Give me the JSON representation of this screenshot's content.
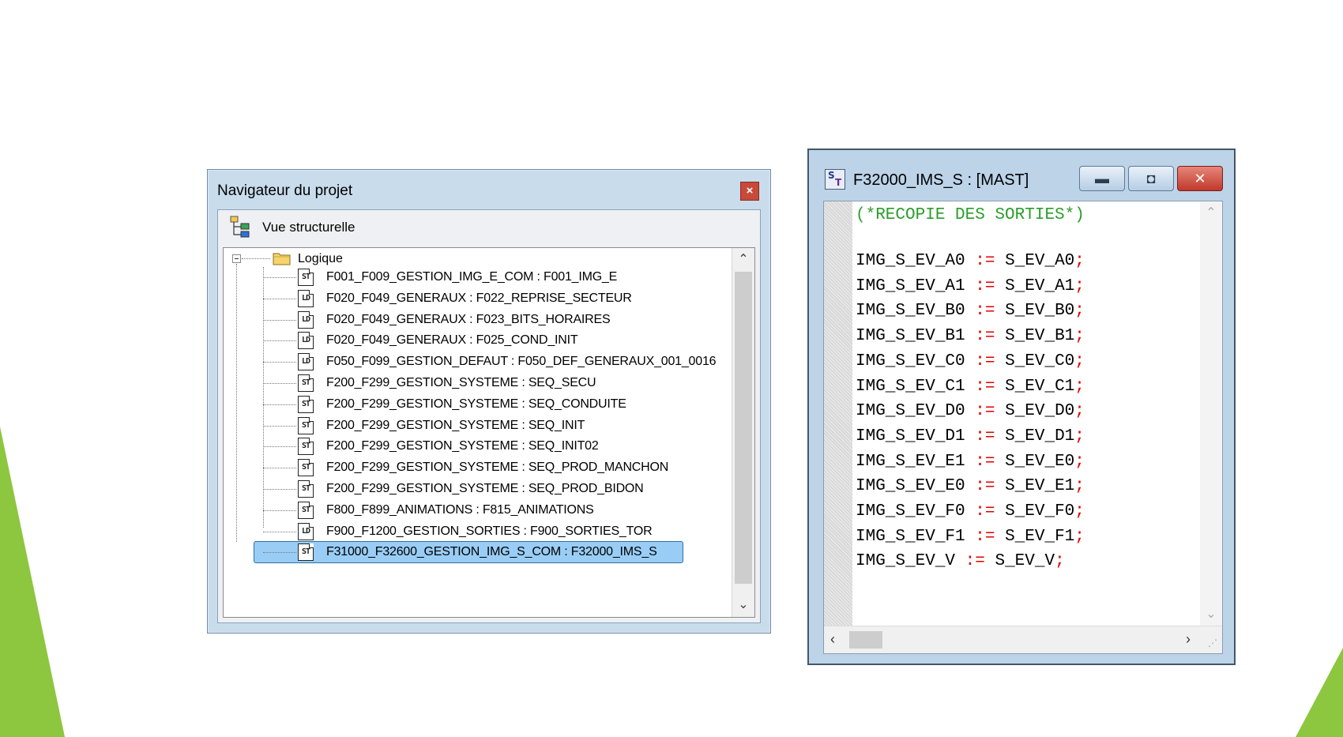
{
  "navigator": {
    "title": "Navigateur du projet",
    "close_glyph": "×",
    "view_label": "Vue structurelle",
    "root_label": "Logique",
    "items": [
      {
        "type": "ST",
        "label": "F001_F009_GESTION_IMG_E_COM : F001_IMG_E",
        "selected": false
      },
      {
        "type": "LD",
        "label": "F020_F049_GENERAUX : F022_REPRISE_SECTEUR",
        "selected": false
      },
      {
        "type": "LD",
        "label": "F020_F049_GENERAUX : F023_BITS_HORAIRES",
        "selected": false
      },
      {
        "type": "LD",
        "label": "F020_F049_GENERAUX : F025_COND_INIT",
        "selected": false
      },
      {
        "type": "LD",
        "label": "F050_F099_GESTION_DEFAUT : F050_DEF_GENERAUX_001_0016",
        "selected": false
      },
      {
        "type": "ST",
        "label": "F200_F299_GESTION_SYSTEME : SEQ_SECU",
        "selected": false
      },
      {
        "type": "ST",
        "label": "F200_F299_GESTION_SYSTEME : SEQ_CONDUITE",
        "selected": false
      },
      {
        "type": "ST",
        "label": "F200_F299_GESTION_SYSTEME : SEQ_INIT",
        "selected": false
      },
      {
        "type": "ST",
        "label": "F200_F299_GESTION_SYSTEME : SEQ_INIT02",
        "selected": false
      },
      {
        "type": "ST",
        "label": "F200_F299_GESTION_SYSTEME : SEQ_PROD_MANCHON",
        "selected": false
      },
      {
        "type": "ST",
        "label": "F200_F299_GESTION_SYSTEME : SEQ_PROD_BIDON",
        "selected": false
      },
      {
        "type": "ST",
        "label": "F800_F899_ANIMATIONS : F815_ANIMATIONS",
        "selected": false
      },
      {
        "type": "LD",
        "label": "F900_F1200_GESTION_SORTIES : F900_SORTIES_TOR",
        "selected": false
      },
      {
        "type": "ST",
        "label": "F31000_F32600_GESTION_IMG_S_COM : F32000_IMS_S",
        "selected": true
      }
    ]
  },
  "editor": {
    "title": "F32000_IMS_S : [MAST]",
    "icon_text": [
      "S",
      "T"
    ],
    "buttons": {
      "minimize": "▬",
      "maximize": "◘",
      "close": "✕"
    },
    "code": {
      "comment": "(*RECOPIE DES SORTIES*)",
      "assignments": [
        {
          "lhs": "IMG_S_EV_A0",
          "rhs": "S_EV_A0"
        },
        {
          "lhs": "IMG_S_EV_A1",
          "rhs": "S_EV_A1"
        },
        {
          "lhs": "IMG_S_EV_B0",
          "rhs": "S_EV_B0"
        },
        {
          "lhs": "IMG_S_EV_B1",
          "rhs": "S_EV_B1"
        },
        {
          "lhs": "IMG_S_EV_C0",
          "rhs": "S_EV_C0"
        },
        {
          "lhs": "IMG_S_EV_C1",
          "rhs": "S_EV_C1"
        },
        {
          "lhs": "IMG_S_EV_D0",
          "rhs": "S_EV_D0"
        },
        {
          "lhs": "IMG_S_EV_D1",
          "rhs": "S_EV_D1"
        },
        {
          "lhs": "IMG_S_EV_E1",
          "rhs": "S_EV_E0"
        },
        {
          "lhs": "IMG_S_EV_E0",
          "rhs": "S_EV_E1"
        },
        {
          "lhs": "IMG_S_EV_F0",
          "rhs": "S_EV_F0"
        },
        {
          "lhs": "IMG_S_EV_F1",
          "rhs": "S_EV_F1"
        },
        {
          "lhs": "IMG_S_EV_V",
          "rhs": "S_EV_V"
        }
      ],
      "operator": ":=",
      "terminator": ";"
    }
  },
  "colors": {
    "accent_green": "#8dc63f",
    "comment_green": "#2a9d2a",
    "operator_red": "#e00000",
    "selection_blue": "#99cdf5",
    "close_red": "#c74a3a"
  }
}
